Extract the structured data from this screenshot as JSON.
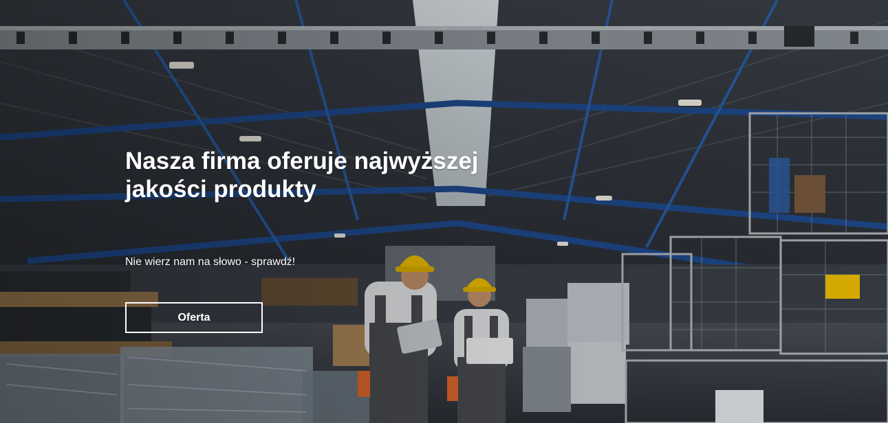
{
  "hero": {
    "title": "Nasza firma oferuje najwyższej jakości produkty",
    "subtitle": "Nie wierz nam na słowo - sprawdź!",
    "cta_label": "Oferta",
    "background_image": "factory-hall-workers-photo"
  },
  "colors": {
    "text": "#ffffff",
    "button_border": "#ffffff",
    "steel_blue": "#1f4b8f",
    "helmet_yellow": "#f2c200"
  }
}
